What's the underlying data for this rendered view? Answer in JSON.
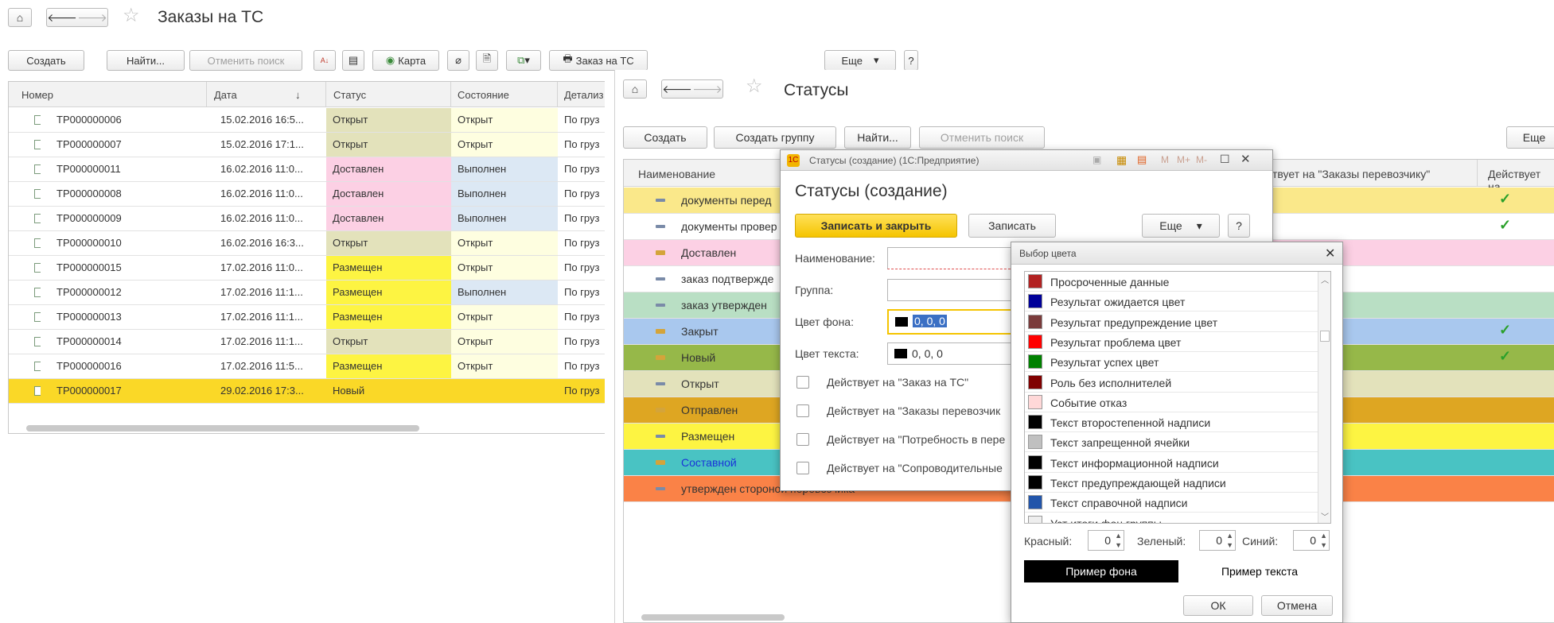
{
  "win1": {
    "title": "Заказы на ТС",
    "toolbar": {
      "create": "Создать",
      "find": "Найти...",
      "cancel_search": "Отменить поиск",
      "map": "Карта",
      "order": "Заказ на ТС",
      "more": "Еще",
      "help": "?"
    },
    "columns": [
      "Номер",
      "Дата",
      "Статус",
      "Состояние",
      "Детализ"
    ],
    "sort_arrow": "↓",
    "rows": [
      {
        "num": "ТР000000006",
        "date": "15.02.2016 16:5...",
        "status": "Открыт",
        "state": "Открыт",
        "det": "По груз"
      },
      {
        "num": "ТР000000007",
        "date": "15.02.2016 17:1...",
        "status": "Открыт",
        "state": "Открыт",
        "det": "По груз"
      },
      {
        "num": "ТР000000011",
        "date": "16.02.2016 11:0...",
        "status": "Доставлен",
        "state": "Выполнен",
        "det": "По груз"
      },
      {
        "num": "ТР000000008",
        "date": "16.02.2016 11:0...",
        "status": "Доставлен",
        "state": "Выполнен",
        "det": "По груз"
      },
      {
        "num": "ТР000000009",
        "date": "16.02.2016 11:0...",
        "status": "Доставлен",
        "state": "Выполнен",
        "det": "По груз"
      },
      {
        "num": "ТР000000010",
        "date": "16.02.2016 16:3...",
        "status": "Открыт",
        "state": "Открыт",
        "det": "По груз"
      },
      {
        "num": "ТР000000015",
        "date": "17.02.2016 11:0...",
        "status": "Размещен",
        "state": "Открыт",
        "det": "По груз"
      },
      {
        "num": "ТР000000012",
        "date": "17.02.2016 11:1...",
        "status": "Размещен",
        "state": "Выполнен",
        "det": "По груз"
      },
      {
        "num": "ТР000000013",
        "date": "17.02.2016 11:1...",
        "status": "Размещен",
        "state": "Открыт",
        "det": "По груз"
      },
      {
        "num": "ТР000000014",
        "date": "17.02.2016 11:1...",
        "status": "Открыт",
        "state": "Открыт",
        "det": "По груз"
      },
      {
        "num": "ТР000000016",
        "date": "17.02.2016 11:5...",
        "status": "Размещен",
        "state": "Открыт",
        "det": "По груз"
      },
      {
        "num": "ТР000000017",
        "date": "29.02.2016 17:3...",
        "status": "Новый",
        "state": "",
        "det": "По груз"
      }
    ]
  },
  "win2": {
    "title": "Статусы",
    "toolbar": {
      "create": "Создать",
      "create_group": "Создать группу",
      "find": "Найти...",
      "cancel_search": "Отменить поиск",
      "more": "Еще"
    },
    "col_name": "Наименование",
    "col_carrier": "ствует на \"Заказы перевозчику\"",
    "col_acts": "Действует на",
    "rows": [
      {
        "name": "документы перед",
        "bg": "#fae88a"
      },
      {
        "name": "документы провер",
        "bg": "#ffffff"
      },
      {
        "name": "Доставлен",
        "bg": "#fcd0e4"
      },
      {
        "name": "заказ подтвержде",
        "bg": "#ffffff"
      },
      {
        "name": "заказ утвержден",
        "bg": "#b9dfc4"
      },
      {
        "name": "Закрыт",
        "bg": "#a9c8ee"
      },
      {
        "name": "Новый",
        "bg": "#96b849"
      },
      {
        "name": "Открыт",
        "bg": "#e3e2bb"
      },
      {
        "name": "Отправлен",
        "bg": "#dea622"
      },
      {
        "name": "Размещен",
        "bg": "#fdf442"
      },
      {
        "name": "Составной",
        "bg": "#49c3c3"
      },
      {
        "name": "утвержден стороной перевозчика",
        "bg": "#fa8247"
      }
    ]
  },
  "dlg1": {
    "window_title": "Статусы (создание)  (1С:Предприятие)",
    "heading": "Статусы (создание)",
    "save_close": "Записать и закрыть",
    "save": "Записать",
    "more": "Еще",
    "help": "?",
    "label_name": "Наименование:",
    "label_group": "Группа:",
    "label_bg": "Цвет фона:",
    "value_bg": "0, 0, 0",
    "label_text": "Цвет текста:",
    "value_text": "0, 0, 0",
    "cb1": "Действует на \"Заказ на ТС\"",
    "cb2": "Действует на \"Заказы перевозчик",
    "cb3": "Действует на \"Потребность в пере",
    "cb4": "Действует на \"Сопроводительные",
    "title_letters": [
      "M",
      "M+",
      "M-"
    ]
  },
  "dlg2": {
    "title": "Выбор цвета",
    "colors": [
      {
        "name": "Просроченные данные",
        "color": "#b22222"
      },
      {
        "name": "Результат ожидается цвет",
        "color": "#000099"
      },
      {
        "name": "Результат предупреждение цвет",
        "color": "#7a3b3b"
      },
      {
        "name": "Результат проблема цвет",
        "color": "#ff0000"
      },
      {
        "name": "Результат успех цвет",
        "color": "#008000"
      },
      {
        "name": "Роль без исполнителей",
        "color": "#800000"
      },
      {
        "name": "Событие отказ",
        "color": "#ffd8d8"
      },
      {
        "name": "Текст второстепенной надписи",
        "color": "#000000"
      },
      {
        "name": "Текст запрещенной ячейки",
        "color": "#c0c0c0"
      },
      {
        "name": "Текст информационной надписи",
        "color": "#000000"
      },
      {
        "name": "Текст предупреждающей надписи",
        "color": "#000000"
      },
      {
        "name": "Текст справочной надписи",
        "color": "#2255aa"
      },
      {
        "name": "Уст итоги фон группы",
        "color": "#eeeeee"
      }
    ],
    "label_red": "Красный:",
    "label_green": "Зеленый:",
    "label_blue": "Синий:",
    "red": "0",
    "green": "0",
    "blue": "0",
    "sample_bg": "Пример фона",
    "sample_text": "Пример текста",
    "ok": "ОК",
    "cancel": "Отмена"
  }
}
